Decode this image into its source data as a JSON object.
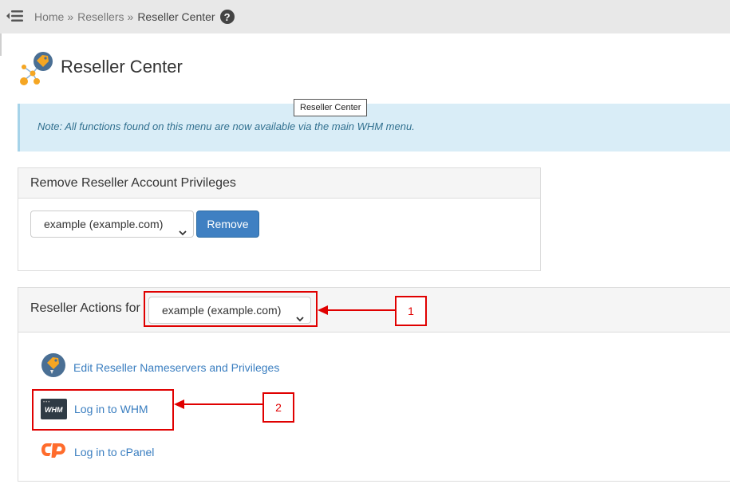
{
  "breadcrumb": {
    "home": "Home",
    "resellers": "Resellers",
    "current": "Reseller Center",
    "separator": "»",
    "help_symbol": "?"
  },
  "page": {
    "title": "Reseller Center"
  },
  "tooltip": {
    "text": "Reseller Center"
  },
  "note": {
    "text": "Note: All functions found on this menu are now available via the main WHM menu."
  },
  "remove_panel": {
    "heading": "Remove Reseller Account Privileges",
    "selected_account": "example (example.com)",
    "button_label": "Remove"
  },
  "actions_panel": {
    "heading": "Reseller Actions for",
    "selected_account": "example (example.com)",
    "items": [
      {
        "label": "Edit Reseller Nameservers and Privileges",
        "icon": "reseller-tag-icon"
      },
      {
        "label": "Log in to WHM",
        "icon": "whm-icon"
      },
      {
        "label": "Log in to cPanel",
        "icon": "cpanel-icon"
      }
    ]
  },
  "whm_icon_text": "WHM",
  "annotations": {
    "callout_1": "1",
    "callout_2": "2",
    "color": "#e00000"
  },
  "colors": {
    "topbar": "#e8e8e8",
    "note_bg": "#d9edf7",
    "note_text": "#31708f",
    "primary_button": "#3f80c2",
    "link": "#3a7ec0",
    "accent_orange": "#f5a623"
  }
}
